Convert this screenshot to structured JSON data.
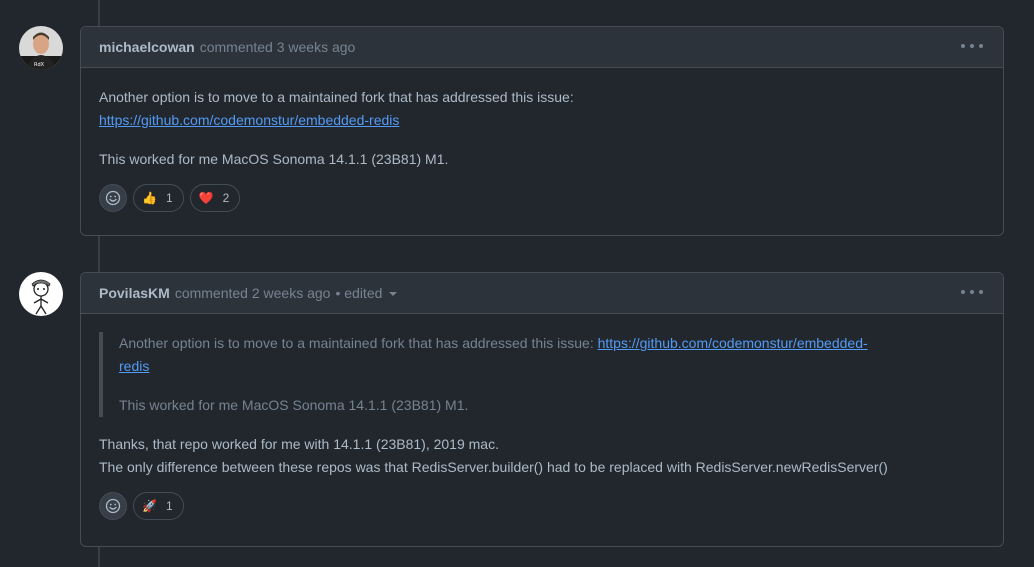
{
  "comments": [
    {
      "author": "michaelcowan",
      "meta": "commented 3 weeks ago",
      "body_line1": "Another option is to move to a maintained fork that has addressed this issue:",
      "link": "https://github.com/codemonstur/embedded-redis",
      "body_line2": "This worked for me MacOS Sonoma 14.1.1 (23B81) M1.",
      "reactions": [
        {
          "emoji": "👍",
          "count": "1",
          "icon": "thumbs-up-icon"
        },
        {
          "emoji": "❤️",
          "count": "2",
          "icon": "heart-icon"
        }
      ]
    },
    {
      "author": "PovilasKM",
      "meta": "commented 2 weeks ago",
      "edited": "• edited",
      "quote_text": "Another option is to move to a maintained fork that has addressed this issue:",
      "quote_link_part1": "https://github.com/codemonstur/embedded-",
      "quote_link_part2": "redis",
      "quote_line2": "This worked for me MacOS Sonoma 14.1.1 (23B81) M1.",
      "body_line1": "Thanks, that repo worked for me with 14.1.1 (23B81), 2019 mac.",
      "body_line2": "The only difference between these repos was that RedisServer.builder() had to be replaced with RedisServer.newRedisServer()",
      "reactions": [
        {
          "emoji": "🚀",
          "count": "1",
          "icon": "rocket-icon"
        }
      ]
    }
  ],
  "colors": {
    "background": "#22272e",
    "header": "#2d333b",
    "border": "#444c56",
    "link": "#539bf5",
    "muted": "#768390"
  }
}
